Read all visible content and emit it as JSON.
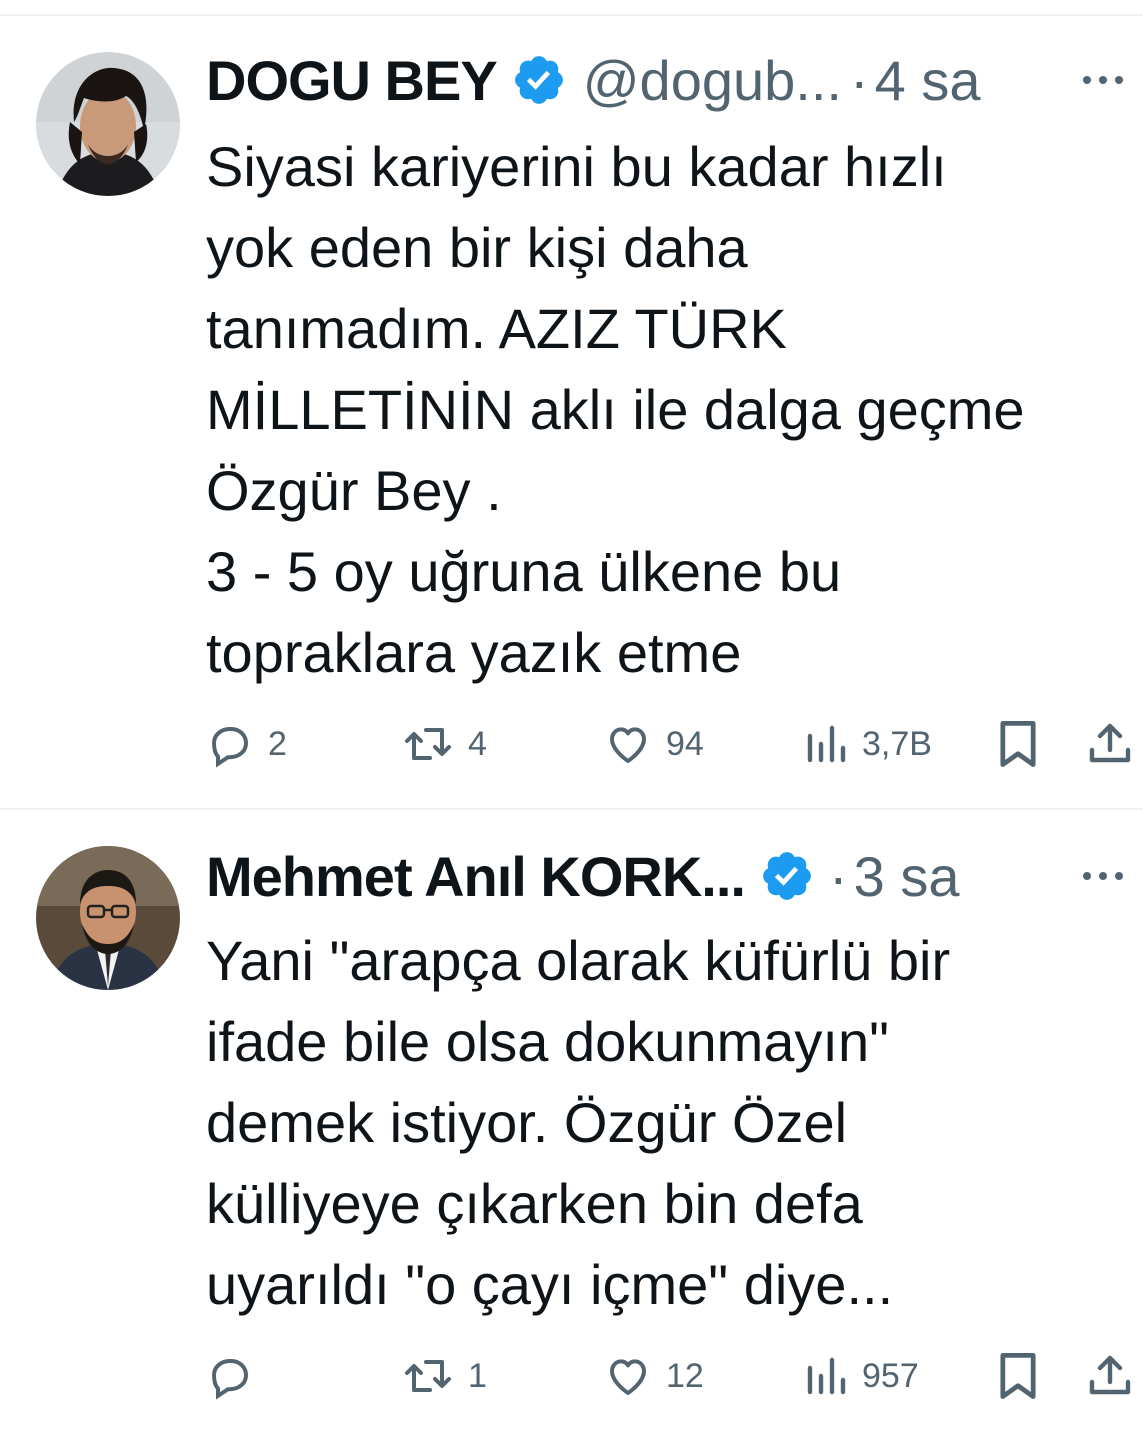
{
  "tweets": [
    {
      "name": "DOGU BEY",
      "handle": "@dogub...",
      "dot": "·",
      "time": "4 sa",
      "lines": [
        "Siyasi kariyerini bu kadar hızlı",
        "yok eden bir kişi daha",
        "tanımadım. AZIZ TÜRK",
        "MİLLETİNİN aklı ile dalga geçme",
        "Özgür Bey .",
        "3 - 5 oy uğruna ülkene bu",
        "topraklara yazık etme"
      ],
      "replies": "2",
      "retweets": "4",
      "likes": "94",
      "views": "3,7B"
    },
    {
      "name": "Mehmet Anıl KORK...",
      "handle": "",
      "dot": "·",
      "time": "3 sa",
      "lines": [
        "Yani \"arapça olarak küfürlü bir",
        "ifade bile olsa dokunmayın\"",
        "demek istiyor. Özgür Özel",
        "külliyeye çıkarken bin defa",
        "uyarıldı \"o çayı içme\" diye..."
      ],
      "replies": "",
      "retweets": "1",
      "likes": "12",
      "views": "957"
    }
  ],
  "icons": {
    "verified": "verified-badge-icon",
    "more": "more-dots-icon",
    "reply": "reply-bubble-icon",
    "retweet": "retweet-icon",
    "like": "heart-icon",
    "views": "views-bars-icon",
    "bookmark": "bookmark-icon",
    "share": "share-icon"
  },
  "colors": {
    "text": "#0f1419",
    "secondary": "#536471",
    "verified": "#1d9bf0",
    "divider": "#eff3f4"
  }
}
